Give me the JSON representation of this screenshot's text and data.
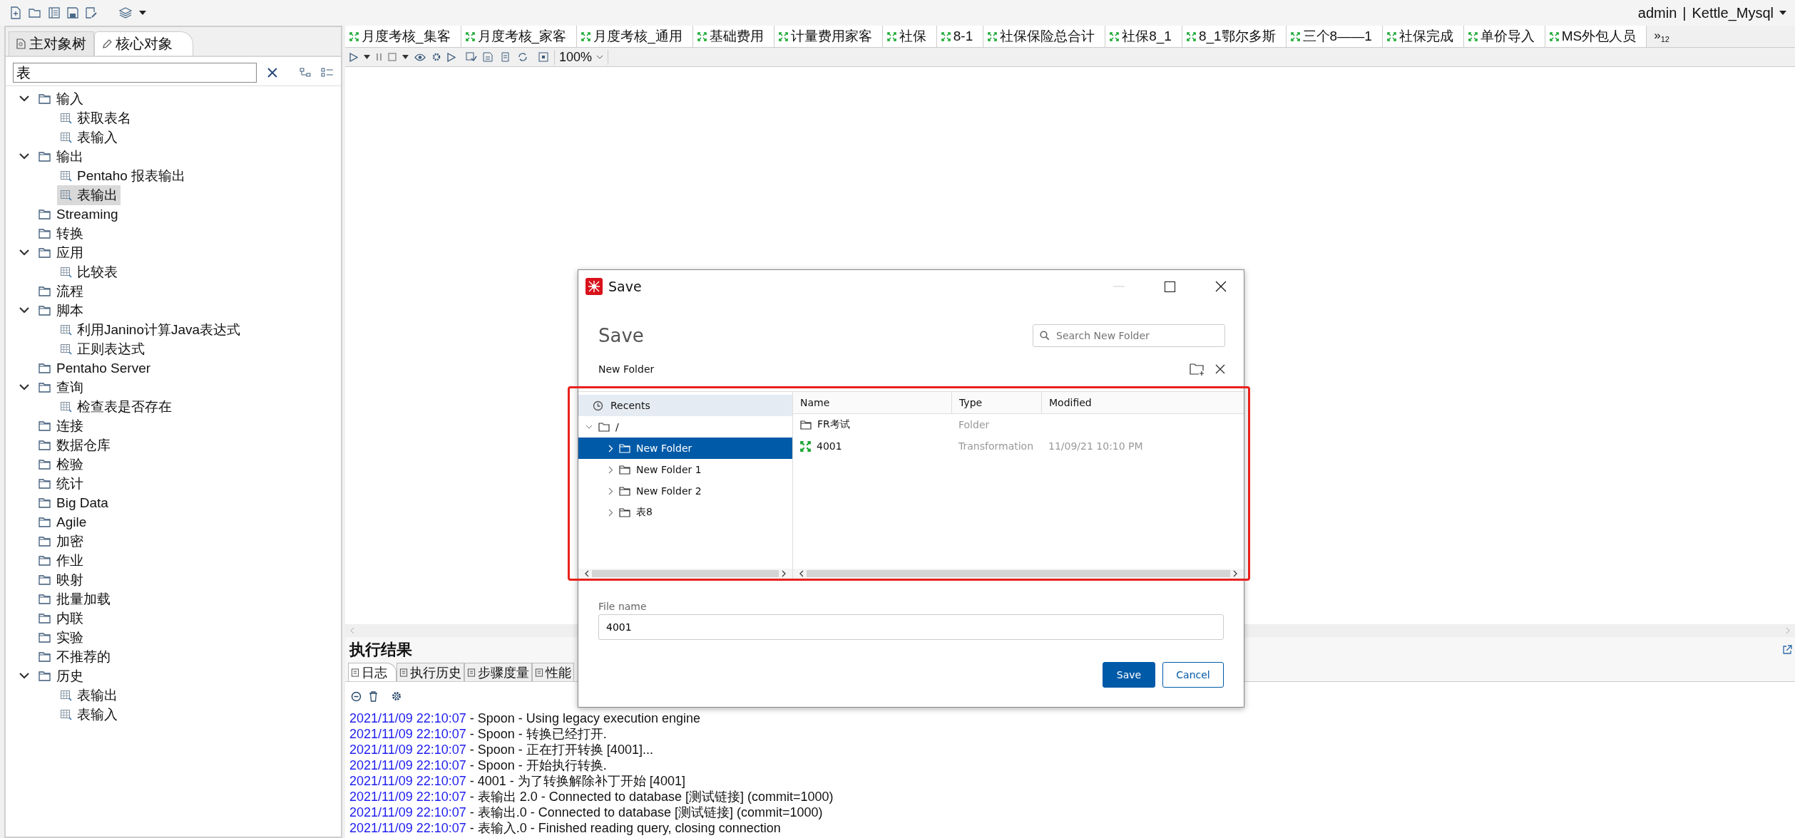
{
  "toolbar": {
    "user": "admin",
    "separator": "|",
    "repository": "Kettle_Mysql"
  },
  "left_tabs": [
    {
      "label": "主对象树",
      "selected": false
    },
    {
      "label": "核心对象",
      "selected": true
    }
  ],
  "search": {
    "value": "表"
  },
  "tree": [
    {
      "label": "输入",
      "expanded": true,
      "children": [
        {
          "label": "获取表名",
          "selected": false
        },
        {
          "label": "表输入",
          "selected": false
        }
      ]
    },
    {
      "label": "输出",
      "expanded": true,
      "children": [
        {
          "label": "Pentaho 报表输出",
          "selected": false
        },
        {
          "label": "表输出",
          "selected": true
        }
      ]
    },
    {
      "label": "Streaming",
      "expanded": false
    },
    {
      "label": "转换",
      "expanded": false
    },
    {
      "label": "应用",
      "expanded": true,
      "children": [
        {
          "label": "比较表",
          "selected": false
        }
      ]
    },
    {
      "label": "流程",
      "expanded": false
    },
    {
      "label": "脚本",
      "expanded": true,
      "children": [
        {
          "label": "利用Janino计算Java表达式",
          "selected": false
        },
        {
          "label": "正则表达式",
          "selected": false
        }
      ]
    },
    {
      "label": "Pentaho Server",
      "expanded": false
    },
    {
      "label": "查询",
      "expanded": true,
      "children": [
        {
          "label": "检查表是否存在",
          "selected": false
        }
      ]
    },
    {
      "label": "连接",
      "expanded": false
    },
    {
      "label": "数据仓库",
      "expanded": false
    },
    {
      "label": "检验",
      "expanded": false
    },
    {
      "label": "统计",
      "expanded": false
    },
    {
      "label": "Big Data",
      "expanded": false
    },
    {
      "label": "Agile",
      "expanded": false
    },
    {
      "label": "加密",
      "expanded": false
    },
    {
      "label": "作业",
      "expanded": false
    },
    {
      "label": "映射",
      "expanded": false
    },
    {
      "label": "批量加载",
      "expanded": false
    },
    {
      "label": "内联",
      "expanded": false
    },
    {
      "label": "实验",
      "expanded": false
    },
    {
      "label": "不推荐的",
      "expanded": false
    },
    {
      "label": "历史",
      "expanded": true,
      "children": [
        {
          "label": "表输出",
          "selected": false
        },
        {
          "label": "表输入",
          "selected": false
        }
      ]
    }
  ],
  "file_tabs": [
    "月度考核_集客",
    "月度考核_家客",
    "月度考核_通用",
    "基础费用",
    "计量费用家客",
    "社保",
    "8-1",
    "社保保险总合计",
    "社保8_1",
    "8_1鄂尔多斯",
    "三个8——1",
    "社保完成",
    "单价导入",
    "MS外包人员"
  ],
  "tab_overflow": {
    "mark": "»",
    "count": "12"
  },
  "zoom": "100%",
  "results": {
    "title": "执行结果",
    "tabs": [
      {
        "label": "日志",
        "selected": true
      },
      {
        "label": "执行历史",
        "selected": false
      },
      {
        "label": "步骤度量",
        "selected": false
      },
      {
        "label": "性能",
        "selected": false
      }
    ],
    "log": [
      {
        "time": "2021/11/09 22:10:07",
        "message": " - Spoon - Using legacy execution engine"
      },
      {
        "time": "2021/11/09 22:10:07",
        "message": " - Spoon - 转换已经打开."
      },
      {
        "time": "2021/11/09 22:10:07",
        "message": " - Spoon - 正在打开转换 [4001]..."
      },
      {
        "time": "2021/11/09 22:10:07",
        "message": " - Spoon - 开始执行转换."
      },
      {
        "time": "2021/11/09 22:10:07",
        "message": " - 4001 - 为了转换解除补丁开始  [4001]"
      },
      {
        "time": "2021/11/09 22:10:07",
        "message": " - 表输出 2.0 - Connected to database [测试链接] (commit=1000)"
      },
      {
        "time": "2021/11/09 22:10:07",
        "message": " - 表输出.0 - Connected to database [测试链接] (commit=1000)"
      },
      {
        "time": "2021/11/09 22:10:07",
        "message": " - 表输入.0 - Finished reading query, closing connection"
      }
    ]
  },
  "dialog": {
    "title": "Save",
    "heading": "Save",
    "search_placeholder": "Search New Folder",
    "location": "New Folder",
    "recents": "Recents",
    "root": {
      "label": "/",
      "expanded": true
    },
    "folders": [
      {
        "label": "New Folder",
        "selected": true
      },
      {
        "label": "New Folder 1",
        "selected": false
      },
      {
        "label": "New Folder 2",
        "selected": false
      },
      {
        "label": "表8",
        "selected": false
      }
    ],
    "columns": [
      "Name",
      "Type",
      "Modified"
    ],
    "files": [
      {
        "kind": "folder",
        "name": "FR考试",
        "type": "Folder"
      },
      {
        "kind": "transformation",
        "name": "4001",
        "type": "Transformation",
        "modified": "11/09/21 10:10 PM"
      }
    ],
    "file_name_label": "File name",
    "file_name": "4001",
    "buttons": [
      {
        "label": "Save",
        "kind": "primary"
      },
      {
        "label": "Cancel",
        "kind": "secondary"
      }
    ]
  },
  "highlight": {
    "color": "#e8211c"
  }
}
